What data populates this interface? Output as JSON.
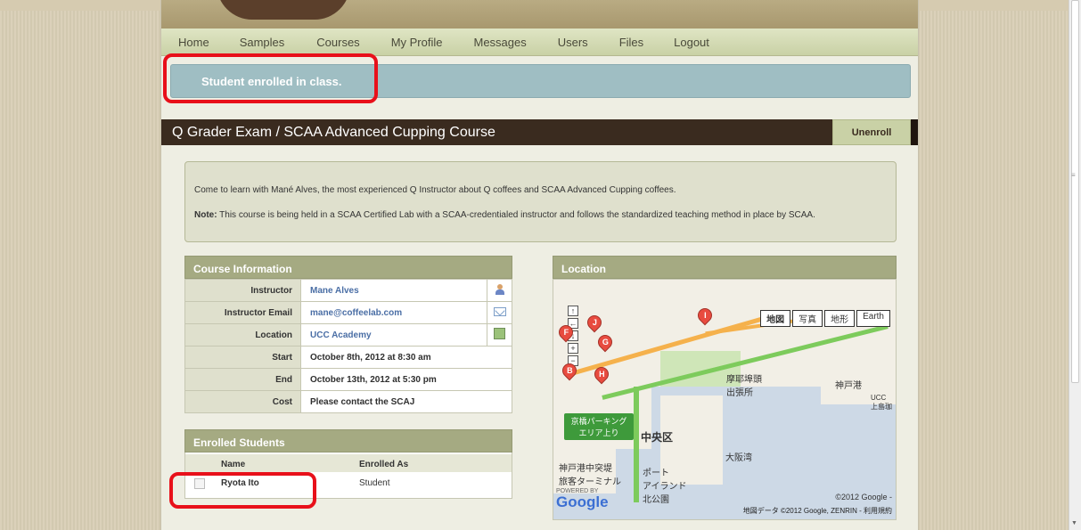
{
  "nav": {
    "items": [
      "Home",
      "Samples",
      "Courses",
      "My Profile",
      "Messages",
      "Users",
      "Files",
      "Logout"
    ]
  },
  "flash": {
    "message": "Student enrolled in class."
  },
  "course": {
    "title": "Q Grader Exam / SCAA Advanced Cupping Course",
    "unenroll_label": "Unenroll",
    "description": "Come to learn with Mané Alves, the most experienced Q Instructor about Q coffees and SCAA Advanced Cupping coffees.",
    "note_label": "Note:",
    "note_text": " This course is being held in a SCAA Certified Lab with a SCAA-credentialed instructor and follows the standardized teaching method in place by SCAA."
  },
  "info": {
    "heading": "Course Information",
    "rows": [
      {
        "label": "Instructor",
        "value": "Mane Alves"
      },
      {
        "label": "Instructor Email",
        "value": "mane@coffeelab.com"
      },
      {
        "label": "Location",
        "value": "UCC Academy"
      },
      {
        "label": "Start",
        "value": "October 8th, 2012 at 8:30 am"
      },
      {
        "label": "End",
        "value": "October 13th, 2012 at 5:30 pm"
      },
      {
        "label": "Cost",
        "value": "Please contact the SCAJ"
      }
    ]
  },
  "students": {
    "heading": "Enrolled Students",
    "col_name": "Name",
    "col_role": "Enrolled As",
    "rows": [
      {
        "name": "Ryota Ito",
        "role": "Student"
      }
    ]
  },
  "location": {
    "heading": "Location",
    "map_types": [
      "地図",
      "写真",
      "地形",
      "Earth"
    ],
    "labels": {
      "central": "中央区",
      "kobeport": "神戸港",
      "pier": "摩耶埠頭\n出張所",
      "osaka_bay": "大阪湾",
      "terminal": "神戸港中突堤\n旅客ターミナル",
      "port_island": "ポート\nアイランド\n北公園",
      "ucc": "UCC\n上島珈",
      "parking": "京橋パーキング\nエリア上り",
      "pin_letters": [
        "J",
        "F",
        "G",
        "I",
        "B",
        "H"
      ]
    },
    "copyright_top": "©2012 Google -",
    "copyright_bottom": "地図データ ©2012 Google, ZENRIN - 利用規約",
    "google_logo": "Google",
    "powered_by": "POWERED BY"
  }
}
